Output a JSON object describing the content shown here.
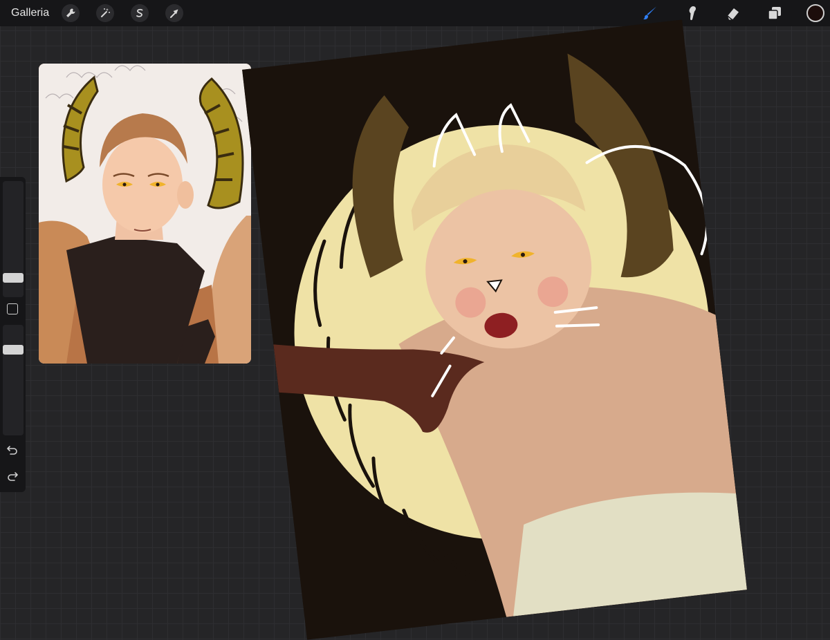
{
  "toolbar": {
    "gallery_label": "Galleria",
    "tools_left": [
      "wrench-icon",
      "magic-wand-icon",
      "selection-icon",
      "transform-arrow-icon"
    ],
    "tools_right": [
      "brush-icon",
      "smudge-icon",
      "eraser-icon",
      "layers-icon"
    ],
    "active_tool": "brush-icon",
    "current_color": "#1c0d0b",
    "accent": "#2f7ff5"
  },
  "sidebar": {
    "brush_size": 0.5,
    "opacity": 0.5,
    "icons": [
      "modify-square-icon",
      "undo-icon",
      "redo-icon"
    ]
  },
  "canvas": {
    "background": "#1a120c",
    "moon_color": "#efe2a6"
  }
}
